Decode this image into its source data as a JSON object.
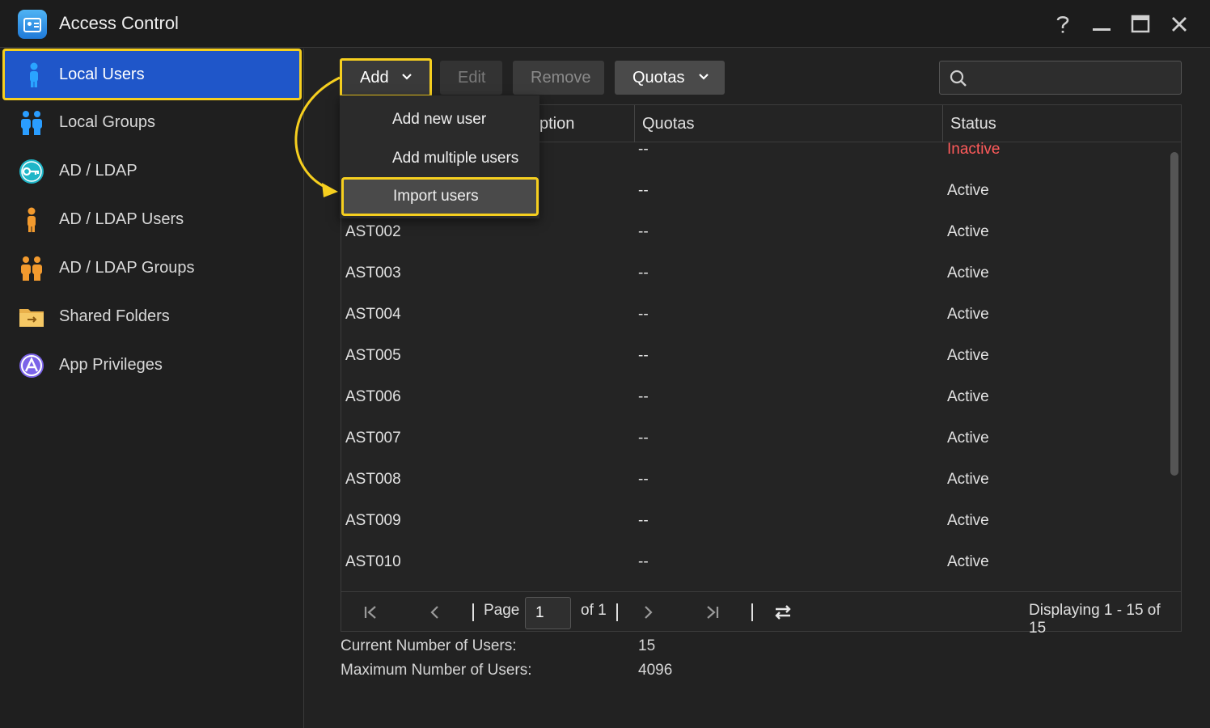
{
  "window": {
    "title": "Access Control",
    "controls": [
      "help-icon",
      "minimize-icon",
      "maximize-icon",
      "close-icon"
    ]
  },
  "sidebar": {
    "items": [
      {
        "label": "Local Users",
        "icon": "user-icon",
        "active": true
      },
      {
        "label": "Local Groups",
        "icon": "group-icon"
      },
      {
        "label": "AD / LDAP",
        "icon": "key-icon"
      },
      {
        "label": "AD / LDAP Users",
        "icon": "ldap-user-icon"
      },
      {
        "label": "AD / LDAP Groups",
        "icon": "ldap-group-icon"
      },
      {
        "label": "Shared Folders",
        "icon": "folder-icon"
      },
      {
        "label": "App Privileges",
        "icon": "app-privileges-icon"
      }
    ]
  },
  "toolbar": {
    "add_label": "Add",
    "edit_label": "Edit",
    "remove_label": "Remove",
    "quotas_label": "Quotas",
    "search_placeholder": ""
  },
  "add_menu": {
    "items": [
      "Add new user",
      "Add multiple users",
      "Import users"
    ],
    "highlighted": "Import users"
  },
  "table": {
    "columns": [
      "Description",
      "Quotas",
      "Status"
    ],
    "visible_description_header": "ption",
    "rows": [
      {
        "name": "",
        "quotas": "--",
        "status": "Inactive"
      },
      {
        "name": "",
        "quotas": "--",
        "status": "Active"
      },
      {
        "name": "AST002",
        "quotas": "--",
        "status": "Active"
      },
      {
        "name": "AST003",
        "quotas": "--",
        "status": "Active"
      },
      {
        "name": "AST004",
        "quotas": "--",
        "status": "Active"
      },
      {
        "name": "AST005",
        "quotas": "--",
        "status": "Active"
      },
      {
        "name": "AST006",
        "quotas": "--",
        "status": "Active"
      },
      {
        "name": "AST007",
        "quotas": "--",
        "status": "Active"
      },
      {
        "name": "AST008",
        "quotas": "--",
        "status": "Active"
      },
      {
        "name": "AST009",
        "quotas": "--",
        "status": "Active"
      },
      {
        "name": "AST010",
        "quotas": "--",
        "status": "Active"
      }
    ]
  },
  "pager": {
    "page_label": "Page",
    "page_value": "1",
    "of_label": "of 1",
    "displaying": "Displaying 1 - 15 of 15"
  },
  "stats": {
    "current_label": "Current Number of Users:",
    "current_value": "15",
    "max_label": "Maximum Number of Users:",
    "max_value": "4096"
  },
  "colors": {
    "highlight": "#f6cf1f",
    "active_nav": "#1f56c9",
    "inactive_status": "#ff5b5b"
  }
}
